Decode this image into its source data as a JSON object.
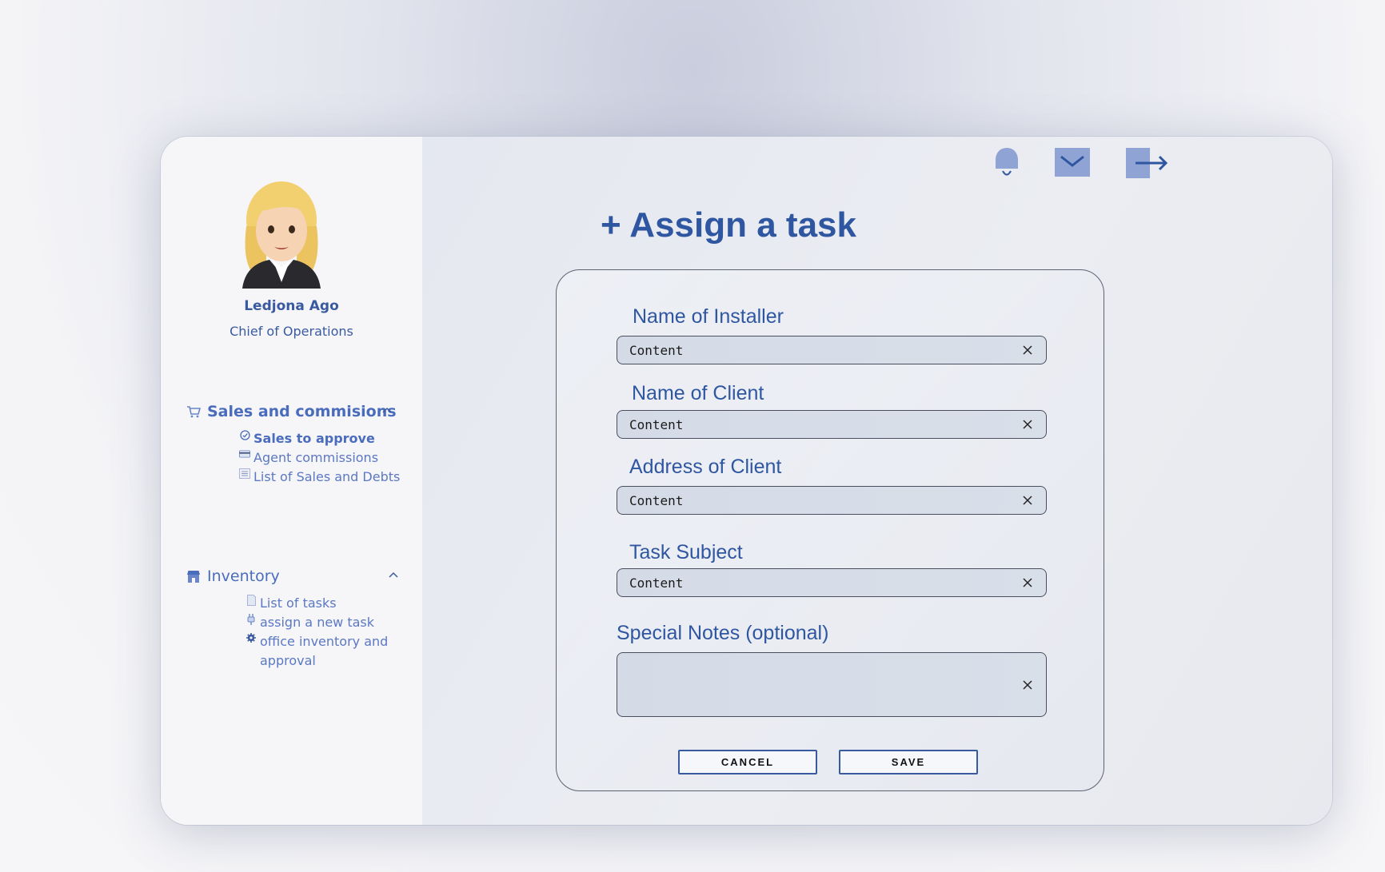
{
  "user": {
    "name": "Ledjona Ago",
    "role": "Chief of Operations"
  },
  "sidebar": {
    "sections": [
      {
        "title": "Sales and commisions",
        "icon": "cart-icon",
        "items": [
          {
            "label": "Sales to approve",
            "icon": "check-circle-icon",
            "active": true
          },
          {
            "label": "Agent commissions",
            "icon": "credit-card-icon"
          },
          {
            "label": "List of Sales and Debts",
            "icon": "ledger-icon"
          }
        ]
      },
      {
        "title": "Inventory",
        "icon": "store-icon",
        "items": [
          {
            "label": "List of tasks",
            "icon": "document-icon"
          },
          {
            "label": "assign a new task",
            "icon": "plug-icon"
          },
          {
            "label": "office inventory and approval",
            "icon": "gear-icon"
          }
        ]
      }
    ]
  },
  "header": {
    "icons": [
      "bell-icon",
      "mail-icon",
      "logout-icon"
    ]
  },
  "main": {
    "title": "+ Assign a task",
    "fields": [
      {
        "label": "Name of Installer",
        "value": "Content"
      },
      {
        "label": "Name of Client",
        "value": "Content"
      },
      {
        "label": "Address of Client",
        "value": "Content"
      },
      {
        "label": "Task Subject",
        "value": "Content"
      },
      {
        "label": "Special Notes (optional)",
        "value": ""
      }
    ],
    "cancel_label": "CANCEL",
    "save_label": "SAVE"
  },
  "colors": {
    "accent": "#2f56a0",
    "link": "#5b78c3",
    "icon": "#8fa3d4"
  }
}
